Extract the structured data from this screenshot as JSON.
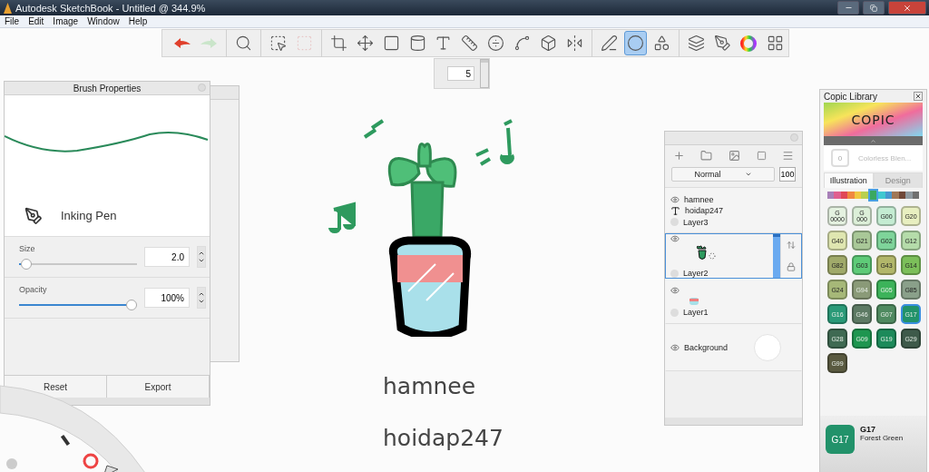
{
  "window": {
    "title": "Autodesk SketchBook - Untitled @ 344.9%"
  },
  "menu": [
    "File",
    "Edit",
    "Image",
    "Window",
    "Help"
  ],
  "toolbar": {
    "tools": [
      {
        "selected": false,
        "disabled": false
      },
      {
        "selected": false,
        "disabled": true
      },
      {
        "selected": false,
        "disabled": false
      },
      {
        "selected": false,
        "disabled": false
      },
      {
        "selected": false,
        "disabled": true
      },
      {
        "selected": false,
        "disabled": false
      },
      {
        "selected": false,
        "disabled": false
      },
      {
        "selected": false,
        "disabled": false
      },
      {
        "selected": false,
        "disabled": false
      },
      {
        "selected": false,
        "disabled": false
      },
      {
        "selected": false,
        "disabled": false
      },
      {
        "selected": false,
        "disabled": false
      },
      {
        "selected": false,
        "disabled": false
      },
      {
        "selected": false,
        "disabled": false
      },
      {
        "selected": false,
        "disabled": false
      },
      {
        "selected": false,
        "disabled": false
      },
      {
        "selected": true,
        "disabled": false
      },
      {
        "selected": false,
        "disabled": false
      },
      {
        "selected": false,
        "disabled": false
      },
      {
        "selected": false,
        "disabled": false
      },
      {
        "selected": false,
        "disabled": false
      },
      {
        "selected": false,
        "disabled": false
      }
    ]
  },
  "brush_size": {
    "value": "5",
    "level": 0.9
  },
  "brush_properties": {
    "title": "Brush Properties",
    "brush_name": "Inking Pen",
    "size": {
      "label": "Size",
      "value": "2.0",
      "level": 0.02
    },
    "opacity": {
      "label": "Opacity",
      "value": "100%",
      "level": 1
    },
    "buttons": [
      "Reset",
      "Export"
    ]
  },
  "canvas": {
    "texts": [
      "hamnee",
      "hoidap247"
    ]
  },
  "layers": {
    "blend_mode": "Normal",
    "opacity": "100",
    "items": [
      {
        "kind": "text",
        "name": "Layer3",
        "labels": [
          "hamnee",
          "hoidap247"
        ],
        "selected": false
      },
      {
        "kind": "plant",
        "name": "Layer2",
        "selected": true
      },
      {
        "kind": "pot",
        "name": "Layer1",
        "selected": false
      },
      {
        "kind": "background",
        "name": "Background",
        "selected": false
      }
    ]
  },
  "copic": {
    "title": "Copic Library",
    "logo": "COPIC",
    "blender": {
      "code": "0",
      "name": "Colorless Blen..."
    },
    "tabs": [
      {
        "label": "Illustration",
        "selected": true
      },
      {
        "label": "Design",
        "selected": false
      }
    ],
    "hues": [
      {
        "color": "#a880b8",
        "selected": false
      },
      {
        "color": "#e06090",
        "selected": false
      },
      {
        "color": "#e04858",
        "selected": false
      },
      {
        "color": "#f08840",
        "selected": false
      },
      {
        "color": "#f0c840",
        "selected": false
      },
      {
        "color": "#b8d050",
        "selected": false
      },
      {
        "color": "#3aa860",
        "selected": true
      },
      {
        "color": "#40c8d0",
        "selected": false
      },
      {
        "color": "#4898d0",
        "selected": false
      },
      {
        "color": "#a07858",
        "selected": false
      },
      {
        "color": "#704838",
        "selected": false
      },
      {
        "color": "#909aa0",
        "selected": false
      },
      {
        "color": "#707070",
        "selected": false
      }
    ],
    "swatches": [
      {
        "code": "G 0000",
        "color": "#e4f1e0",
        "selected": false
      },
      {
        "code": "G 000",
        "color": "#dcefd8",
        "selected": false
      },
      {
        "code": "G00",
        "color": "#c4ecd2",
        "selected": false
      },
      {
        "code": "G20",
        "color": "#e8efc0",
        "selected": false
      },
      {
        "code": "G40",
        "color": "#dfe6b0",
        "selected": false
      },
      {
        "code": "G21",
        "color": "#a9c898",
        "selected": false
      },
      {
        "code": "G02",
        "color": "#7ed49a",
        "selected": false
      },
      {
        "code": "G12",
        "color": "#b5dcaa",
        "selected": false
      },
      {
        "code": "G82",
        "color": "#a0aa6a",
        "selected": false
      },
      {
        "code": "G03",
        "color": "#5ecb78",
        "selected": false
      },
      {
        "code": "G43",
        "color": "#b2b76a",
        "selected": false
      },
      {
        "code": "G14",
        "color": "#7cbf5a",
        "selected": false
      },
      {
        "code": "G24",
        "color": "#a6b878",
        "selected": false
      },
      {
        "code": "G94",
        "color": "#8a9a78",
        "selected": false
      },
      {
        "code": "G05",
        "color": "#3cb35a",
        "selected": false
      },
      {
        "code": "G85",
        "color": "#8aa08a",
        "selected": false
      },
      {
        "code": "G16",
        "color": "#2a9a78",
        "selected": false
      },
      {
        "code": "G46",
        "color": "#5d7a64",
        "selected": false
      },
      {
        "code": "G07",
        "color": "#4f8a60",
        "selected": false
      },
      {
        "code": "G17",
        "color": "#22926a",
        "selected": true
      },
      {
        "code": "G28",
        "color": "#3f6a52",
        "selected": false
      },
      {
        "code": "G09",
        "color": "#1e9650",
        "selected": false
      },
      {
        "code": "G19",
        "color": "#1c8a5a",
        "selected": false
      },
      {
        "code": "G29",
        "color": "#3e5a4a",
        "selected": false
      },
      {
        "code": "G99",
        "color": "#5a5a40",
        "selected": false
      }
    ],
    "current": {
      "swatch": "G17",
      "code": "G17",
      "name": "Forest Green",
      "color": "#22926a"
    }
  }
}
